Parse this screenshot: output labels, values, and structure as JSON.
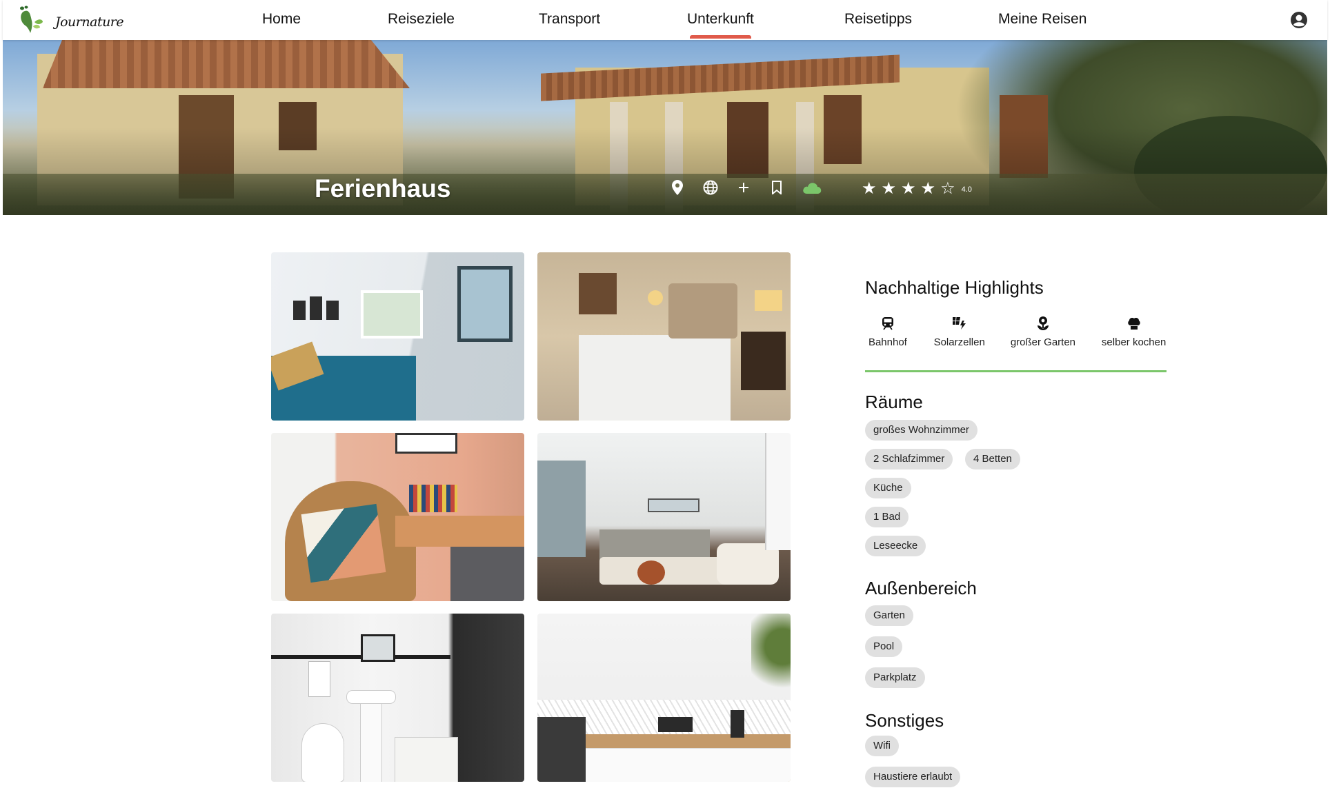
{
  "brand": {
    "name": "Journature"
  },
  "nav": {
    "items": [
      {
        "label": "Home"
      },
      {
        "label": "Reiseziele"
      },
      {
        "label": "Transport"
      },
      {
        "label": "Unterkunft"
      },
      {
        "label": "Reisetipps"
      },
      {
        "label": "Meine Reisen"
      }
    ],
    "active": "Unterkunft"
  },
  "hero": {
    "title": "Ferienhaus",
    "icons": [
      "location-pin-icon",
      "globe-icon",
      "plus-icon",
      "bookmark-icon",
      "cloud-icon"
    ],
    "rating": {
      "value": "4.0",
      "stars_filled": 4,
      "stars_total": 5
    }
  },
  "gallery": {
    "images": [
      "bedroom-blue-bedspread",
      "bedroom-beige-headboard",
      "rattan-chair-desk",
      "living-room-sofa",
      "bathroom",
      "kitchen"
    ]
  },
  "highlights": {
    "title": "Nachhaltige Highlights",
    "items": [
      {
        "label": "Bahnhof",
        "icon": "train-icon"
      },
      {
        "label": "Solarzellen",
        "icon": "solar-panel-icon"
      },
      {
        "label": "großer Garten",
        "icon": "garden-flower-icon"
      },
      {
        "label": "selber kochen",
        "icon": "chef-hat-icon"
      }
    ]
  },
  "rooms": {
    "title": "Räume",
    "chips": [
      "großes Wohnzimmer",
      "2 Schlafzimmer",
      "4 Betten",
      "Küche",
      "1 Bad",
      "Leseecke"
    ]
  },
  "outdoor": {
    "title": "Außenbereich",
    "chips": [
      "Garten",
      "Pool",
      "Parkplatz"
    ]
  },
  "other": {
    "title": "Sonstiges",
    "chips": [
      "Wifi",
      "Haustiere erlaubt"
    ]
  },
  "colors": {
    "accent_underline": "#e05a4a",
    "highlight_line": "#7bc66a",
    "chip_bg": "#e0e0e0"
  }
}
